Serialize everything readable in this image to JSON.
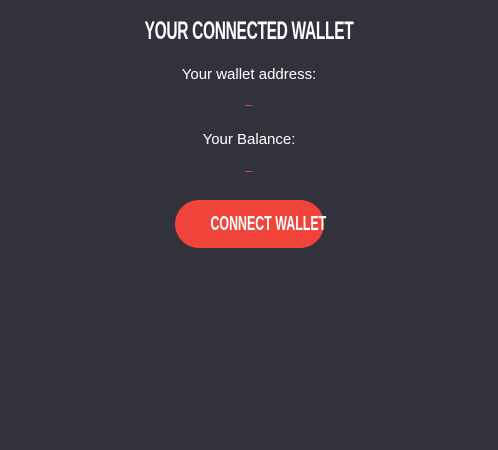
{
  "wallet_panel": {
    "title": "YOUR CONNECTED WALLET",
    "address_label": "Your wallet address:",
    "address_value": "–",
    "balance_label": "Your Balance:",
    "balance_value": "–",
    "connect_button_label": "CONNECT WALLET"
  },
  "colors": {
    "background": "#32323c",
    "accent": "#f0443a",
    "text": "#ffffff"
  }
}
